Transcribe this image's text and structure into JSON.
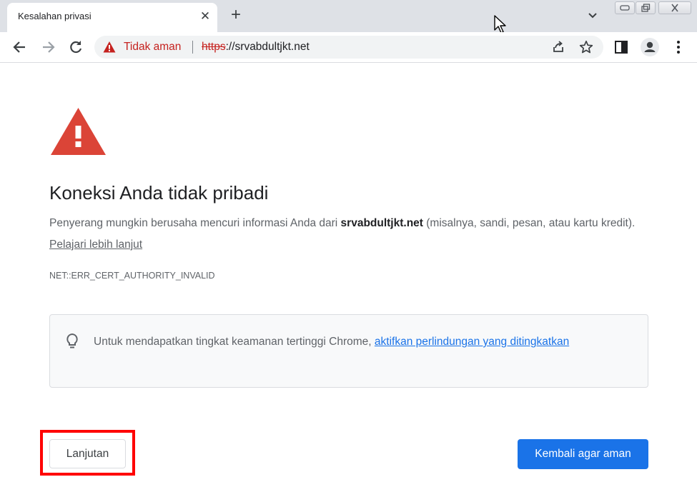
{
  "tab": {
    "title": "Kesalahan privasi",
    "close_symbol": "✕",
    "new_tab_symbol": "+"
  },
  "omnibox": {
    "security_label": "Tidak aman",
    "url_scheme": "https",
    "url_rest": "://srvabdultjkt.net"
  },
  "page": {
    "heading": "Koneksi Anda tidak pribadi",
    "desc_before": "Penyerang mungkin berusaha mencuri informasi Anda dari ",
    "desc_domain": "srvabdultjkt.net",
    "desc_after": " (misalnya, sandi, pesan, atau kartu kredit). ",
    "learn_more": "Pelajari lebih lanjut",
    "error_code": "NET::ERR_CERT_AUTHORITY_INVALID",
    "info_text": "Untuk mendapatkan tingkat keamanan tertinggi Chrome, ",
    "info_link": "aktifkan perlindungan yang ditingkatkan",
    "advanced_button": "Lanjutan",
    "back_button": "Kembali agar aman"
  },
  "colors": {
    "warning_red": "#db4437",
    "primary_blue": "#1a73e8",
    "highlight_red": "#ff0000",
    "tabstrip_bg": "#dee1e6"
  },
  "icons": [
    "back-arrow-icon",
    "forward-arrow-icon",
    "reload-icon",
    "warning-triangle-icon",
    "share-icon",
    "star-icon",
    "side-panel-icon",
    "profile-icon",
    "more-menu-icon",
    "lightbulb-icon",
    "chevron-down-icon",
    "minimize-icon",
    "restore-icon",
    "close-icon",
    "mouse-cursor-icon"
  ]
}
